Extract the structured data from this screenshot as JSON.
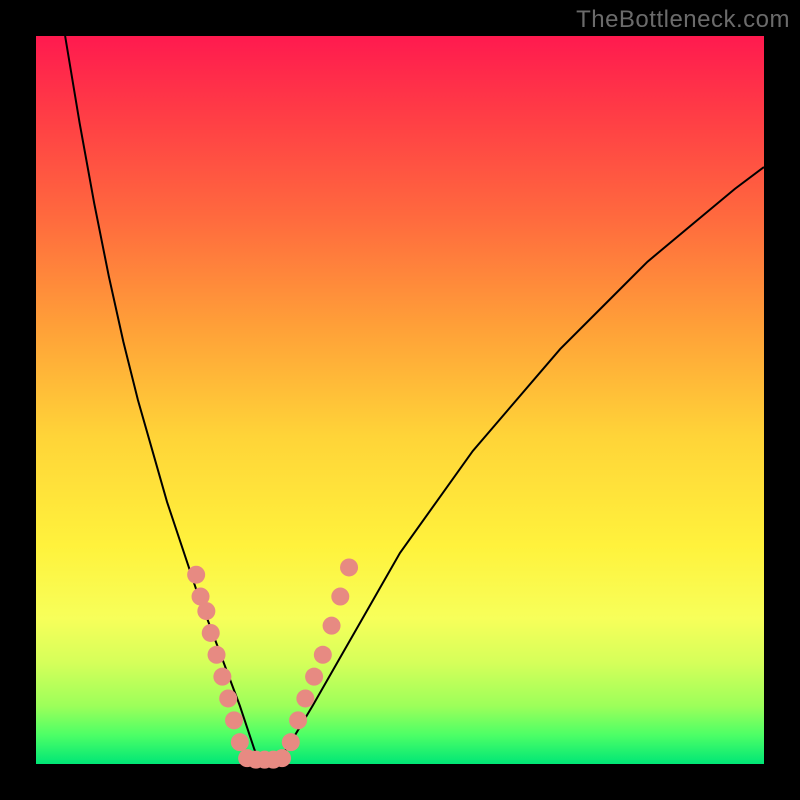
{
  "watermark": "TheBottleneck.com",
  "chart_data": {
    "type": "line",
    "title": "",
    "xlabel": "",
    "ylabel": "",
    "xlim": [
      0,
      100
    ],
    "ylim": [
      0,
      100
    ],
    "grid": false,
    "annotations": [],
    "series": [
      {
        "name": "left-curve",
        "x": [
          4,
          6,
          8,
          10,
          12,
          14,
          16,
          18,
          20,
          22,
          23.5,
          25,
          26.5,
          28,
          29,
          30,
          31
        ],
        "values": [
          100,
          88,
          77,
          67,
          58,
          50,
          43,
          36,
          30,
          24,
          20,
          16,
          12,
          8,
          5,
          2,
          0
        ]
      },
      {
        "name": "right-curve",
        "x": [
          33,
          35,
          38,
          42,
          46,
          50,
          55,
          60,
          66,
          72,
          78,
          84,
          90,
          96,
          100
        ],
        "values": [
          0,
          3,
          8,
          15,
          22,
          29,
          36,
          43,
          50,
          57,
          63,
          69,
          74,
          79,
          82
        ]
      }
    ],
    "dot_clusters": [
      {
        "name": "left-dots",
        "x": [
          22.0,
          22.6,
          23.4,
          24.0,
          24.8,
          25.6,
          26.4,
          27.2,
          28.0
        ],
        "values": [
          26,
          23,
          21,
          18,
          15,
          12,
          9,
          6,
          3
        ]
      },
      {
        "name": "bottom-dots",
        "x": [
          29.0,
          30.2,
          31.4,
          32.6,
          33.8
        ],
        "values": [
          0.8,
          0.6,
          0.6,
          0.6,
          0.8
        ]
      },
      {
        "name": "right-dots",
        "x": [
          35.0,
          36.0,
          37.0,
          38.2,
          39.4,
          40.6,
          41.8,
          43.0
        ],
        "values": [
          3,
          6,
          9,
          12,
          15,
          19,
          23,
          27
        ]
      }
    ],
    "dot_color": "#e78a82",
    "curve_color": "#000000"
  }
}
